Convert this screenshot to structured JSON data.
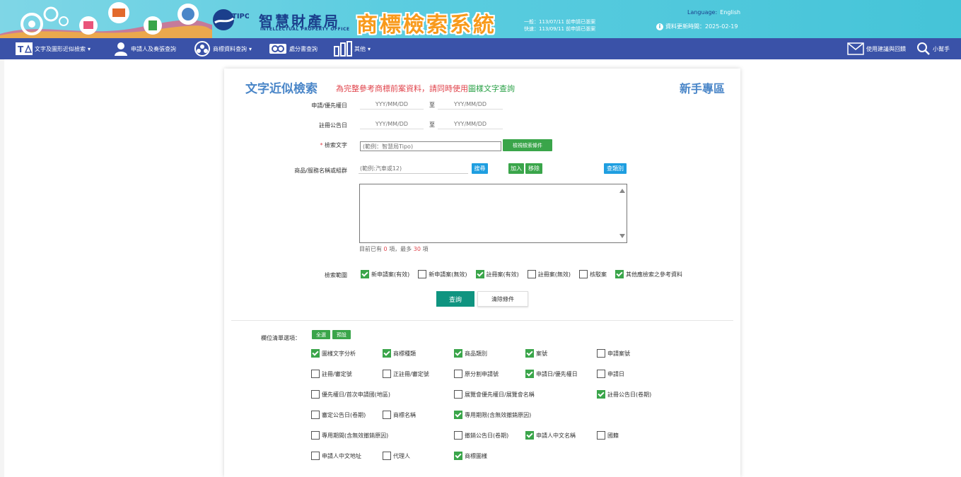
{
  "header": {
    "org_name": "智慧財產局",
    "org_en": "INTELLECTUAL PROPERTY OFFICE",
    "logo_text": "TIPO",
    "system_title": "商標檢索系統",
    "date_normal": "一般：113/07/11 前申請已張案",
    "date_fast": "快速：113/09/11 前申請已張案",
    "language_label": "Language:",
    "language_value": "English",
    "updated": "資料更新時間：2025-02-19"
  },
  "nav": {
    "items": [
      {
        "label": "文字及圖形近似檢索",
        "icon": "text-image-icon"
      },
      {
        "label": "申請人及奏張查詢",
        "icon": "person-icon"
      },
      {
        "label": "商標資料查詢",
        "icon": "data-query-icon"
      },
      {
        "label": "處分書查詢",
        "icon": "document-search-icon"
      },
      {
        "label": "其他",
        "icon": "chart-icon"
      }
    ],
    "feedback": "使用建議與回饋",
    "helper": "小幫手"
  },
  "form": {
    "title": "文字近似檢索",
    "notice_prefix": "為完整參考商標前案資料，請同時使用",
    "notice_link": "圖樣文字查詢",
    "beginner": "新手專區",
    "apply_date_label": "申請/優先權日",
    "reg_date_label": "註冊公告日",
    "date_placeholder": "YYY/MM/DD",
    "to": "至",
    "search_text_label": "檢索文字",
    "required_mark": "*",
    "search_text_placeholder": "(範例：智慧局Tipo)",
    "search_options_btn": "檢視檢索條件",
    "goods_label": "商品/服務名稱或組群",
    "goods_placeholder": "(範例:汽車或12)",
    "search_btn": "搜尋",
    "add_btn": "加入",
    "remove_btn": "移除",
    "category_btn": "查類別",
    "count_prefix": "目前已有",
    "count_value": "0",
    "count_mid": "項，最多",
    "count_max": "30",
    "count_suffix": "項",
    "scope_label": "檢索範圍",
    "scope": [
      {
        "label": "新申請案(有效)",
        "checked": true
      },
      {
        "label": "新申請案(無效)",
        "checked": false
      },
      {
        "label": "註冊案(有效)",
        "checked": true
      },
      {
        "label": "註冊案(無效)",
        "checked": false
      },
      {
        "label": "核駁案",
        "checked": false
      },
      {
        "label": "其他應檢索之參考資料",
        "checked": true
      }
    ],
    "query_btn": "查詢",
    "clear_btn": "清除條件",
    "fields_label": "欄位清單選項：",
    "select_all_btn": "全選",
    "default_btn": "預設",
    "fields": [
      {
        "label": "圖樣文字分析",
        "checked": true
      },
      {
        "label": "商標種類",
        "checked": true
      },
      {
        "label": "商品類別",
        "checked": true
      },
      {
        "label": "案號",
        "checked": true
      },
      {
        "label": "申請案號",
        "checked": false
      },
      {
        "label": "註冊/審定號",
        "checked": false
      },
      {
        "label": "正註冊/審定號",
        "checked": false
      },
      {
        "label": "原分割申請號",
        "checked": false
      },
      {
        "label": "申請日/優先權日",
        "checked": true
      },
      {
        "label": "申請日",
        "checked": false
      },
      {
        "label": "優先權日/首次申請國(地區)",
        "checked": false
      },
      {
        "label": "展覽會優先權日/展覽會名稱",
        "checked": false
      },
      {
        "label": "註冊公告日(卷期)",
        "checked": true
      },
      {
        "label": "審定公告日(卷期)",
        "checked": false
      },
      {
        "label": "商標名稱",
        "checked": false
      },
      {
        "label": "專用期限(含無效撤銷原因)",
        "checked": true
      },
      {
        "label": "專用期間(含無效撤銷原因)",
        "checked": false
      },
      {
        "label": "撤銷公告日(卷期)",
        "checked": false
      },
      {
        "label": "申請人中文名稱",
        "checked": true
      },
      {
        "label": "國籍",
        "checked": false
      },
      {
        "label": "申請人中文地址",
        "checked": false
      },
      {
        "label": "代理人",
        "checked": false
      },
      {
        "label": "商標圖樣",
        "checked": true
      }
    ]
  },
  "colors": {
    "banner": "#5ccde0",
    "nav": "#3a52a8",
    "accent_blue": "#4a86c8",
    "green": "#3aa54a",
    "teal": "#0f9480",
    "red": "#e0434b",
    "title_orange": "#f89a1c"
  }
}
